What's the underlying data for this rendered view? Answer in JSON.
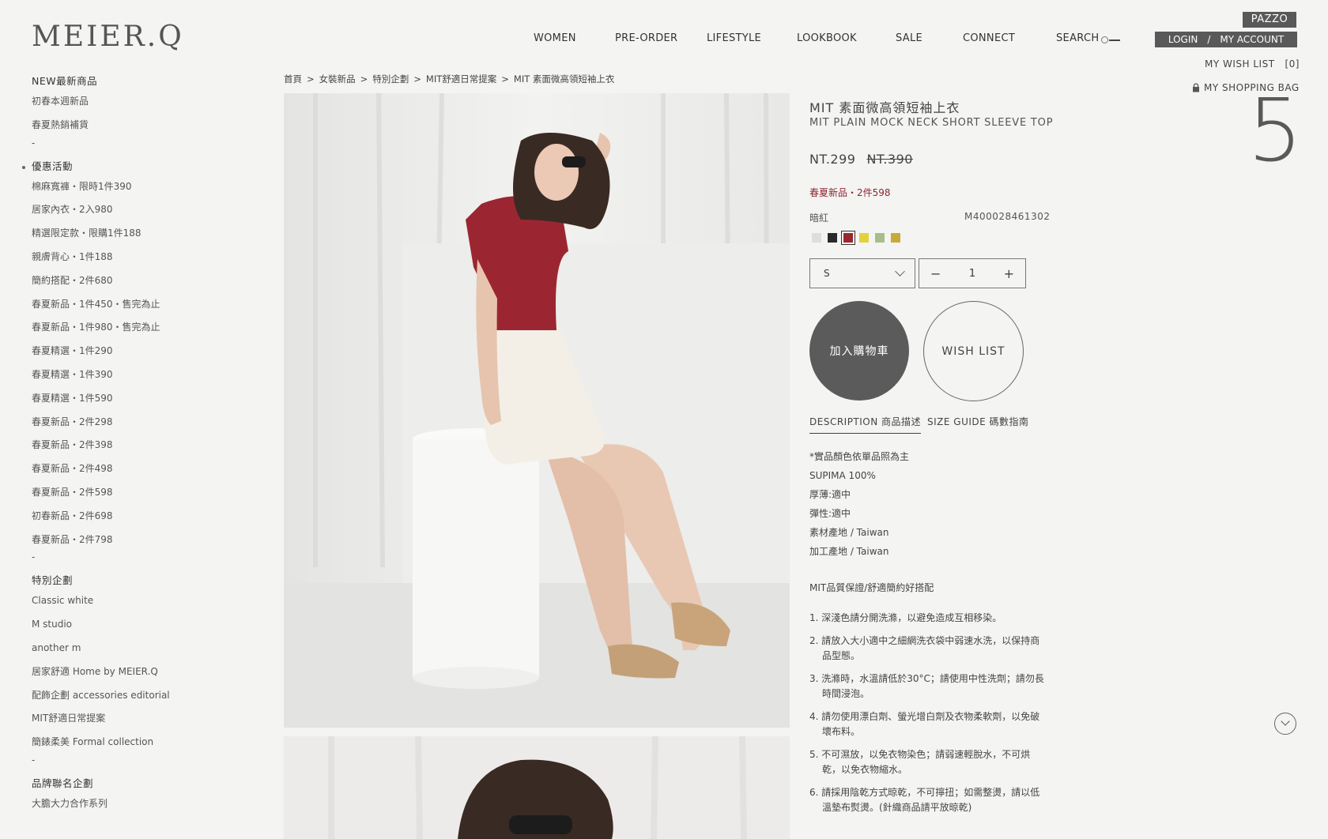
{
  "brand": {
    "logo": "MEIER.Q",
    "sister_brand": "PAZZO"
  },
  "nav": {
    "items": [
      "WOMEN",
      "PRE-ORDER",
      "LIFESTYLE",
      "LOOKBOOK",
      "SALE",
      "CONNECT",
      "SEARCH"
    ]
  },
  "account": {
    "login": "LOGIN",
    "divider": "/",
    "my_account": "MY ACCOUNT",
    "wish_list": "MY WISH LIST",
    "wish_count": "[0]",
    "shopping_bag": "MY SHOPPING BAG",
    "bag_count": "5"
  },
  "sidebar": {
    "sections": [
      {
        "title": "NEW最新商品",
        "active": false,
        "items": [
          "初春本週新品",
          "春夏熱銷補貨"
        ]
      },
      {
        "title": "優惠活動",
        "active": true,
        "items": [
          "棉麻寬褲・限時1件390",
          "居家內衣・2入980",
          "精選限定款・限購1件188",
          "親膚背心・1件188",
          "簡約搭配・2件680",
          "春夏新品・1件450・售完為止",
          "春夏新品・1件980・售完為止",
          "春夏精選・1件290",
          "春夏精選・1件390",
          "春夏精選・1件590",
          "春夏新品・2件298",
          "春夏新品・2件398",
          "春夏新品・2件498",
          "春夏新品・2件598",
          "初春新品・2件698",
          "春夏新品・2件798"
        ]
      },
      {
        "title": "特別企劃",
        "active": false,
        "items": [
          "Classic white",
          "M studio",
          "another m",
          "居家舒適 Home by MEIER.Q",
          "配飾企劃 accessories editorial",
          "MIT舒適日常提案",
          "簡錶柔美 Formal collection"
        ]
      },
      {
        "title": "品牌聯名企劃",
        "active": false,
        "items": [
          "大膽大力合作系列"
        ]
      }
    ],
    "separator": "-"
  },
  "breadcrumb": [
    "首頁",
    "女裝新品",
    "特別企劃",
    "MIT舒適日常提案",
    "MIT 素面微高領短袖上衣"
  ],
  "breadcrumb_sep": ">",
  "product": {
    "title_zh": "MIT 素面微高領短袖上衣",
    "title_en": "MIT PLAIN MOCK NECK SHORT SLEEVE TOP",
    "price": "NT.299",
    "old_price": "NT.390",
    "promo": "春夏新品・2件598",
    "color_name": "暗紅",
    "sku": "M400028461302",
    "swatches": [
      {
        "name": "light-gray",
        "color": "#dededc",
        "selected": false
      },
      {
        "name": "black",
        "color": "#2a2a2a",
        "selected": false
      },
      {
        "name": "dark-red",
        "color": "#9b2631",
        "selected": true
      },
      {
        "name": "yellow",
        "color": "#e3d23a",
        "selected": false
      },
      {
        "name": "sage",
        "color": "#a7bd8a",
        "selected": false
      },
      {
        "name": "mustard",
        "color": "#c9a93a",
        "selected": false
      }
    ],
    "size": "S",
    "quantity": "1",
    "minus": "−",
    "plus": "+",
    "add_to_cart": "加入購物車",
    "wish_list_button": "WISH LIST",
    "tabs": [
      "DESCRIPTION 商品描述",
      "SIZE GUIDE 碼數指南"
    ],
    "description": [
      "*實品顏色依單品照為主",
      "SUPIMA 100%",
      "厚薄:適中",
      "彈性:適中",
      "素材產地 / Taiwan",
      "加工產地 / Taiwan"
    ],
    "subtitle": "MIT品質保證/舒適簡約好搭配",
    "care": [
      "1. 深淺色請分開洗滌，以避免造成互相移染。",
      "2. 請放入大小適中之細網洗衣袋中弱速水洗，以保持商品型態。",
      "3. 洗滌時，水溫請低於30°C；請使用中性洗劑；請勿長時間浸泡。",
      "4. 請勿使用漂白劑、螢光增白劑及衣物柔軟劑，以免破壞布料。",
      "5. 不可濕放，以免衣物染色；請弱速輕脫水，不可烘乾，以免衣物縮水。",
      "6. 請採用陰乾方式晾乾，不可擰扭；如需整燙，請以低溫墊布熨燙。(針織商品請平放晾乾)"
    ]
  },
  "colors": {
    "accent_dark": "#595959",
    "promo_red": "#8c2630",
    "background": "#f4f4f2"
  }
}
